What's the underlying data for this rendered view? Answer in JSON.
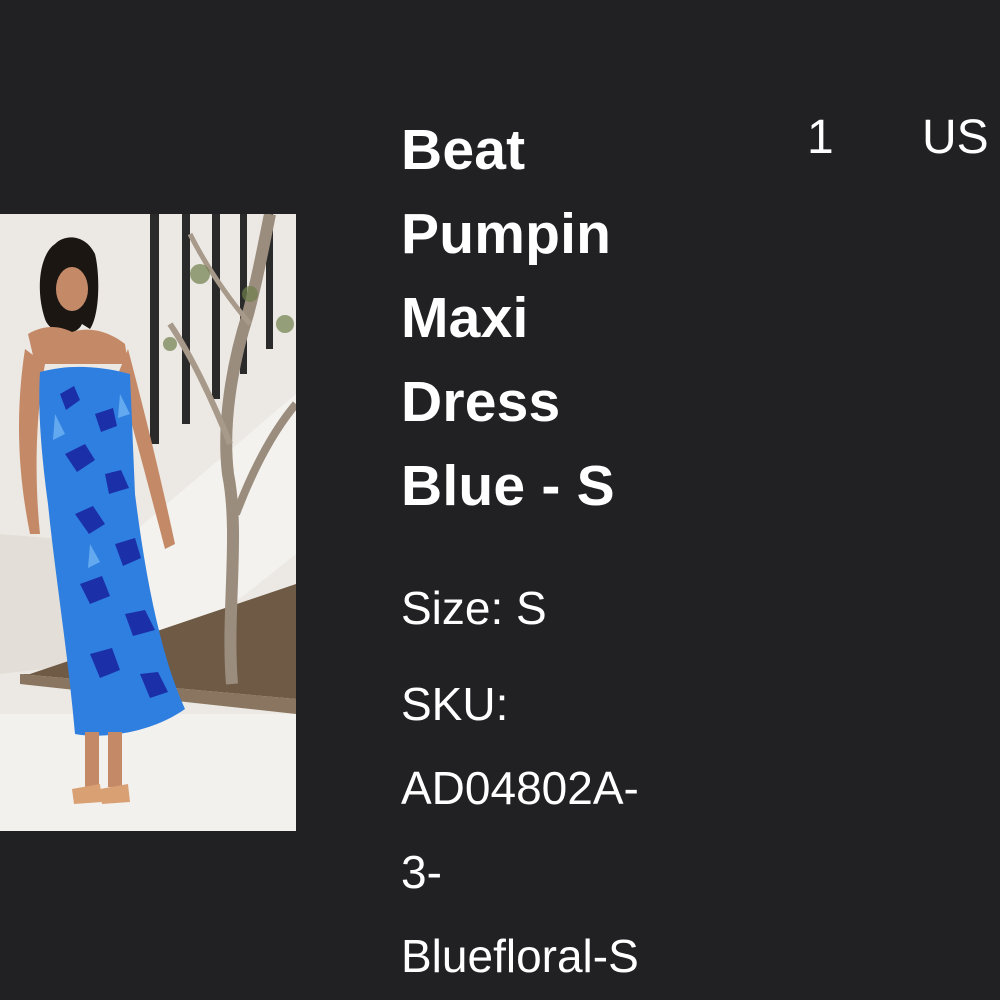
{
  "item": {
    "title": "Beat\nPumpin\nMaxi\nDress\nBlue - S",
    "size_label": "Size:",
    "size_value": "S",
    "sku_label": "SKU:",
    "sku_value": "AD04802A-\n3-\nBluefloral-S",
    "quantity": "1",
    "price_partial": "US"
  },
  "colors": {
    "background": "#212124",
    "text": "#ffffff",
    "dress_primary": "#2f7fe0",
    "dress_dark": "#1b2fa8"
  },
  "icons": {
    "product_image": "woman-in-blue-floral-strapless-maxi-dress-photo"
  }
}
